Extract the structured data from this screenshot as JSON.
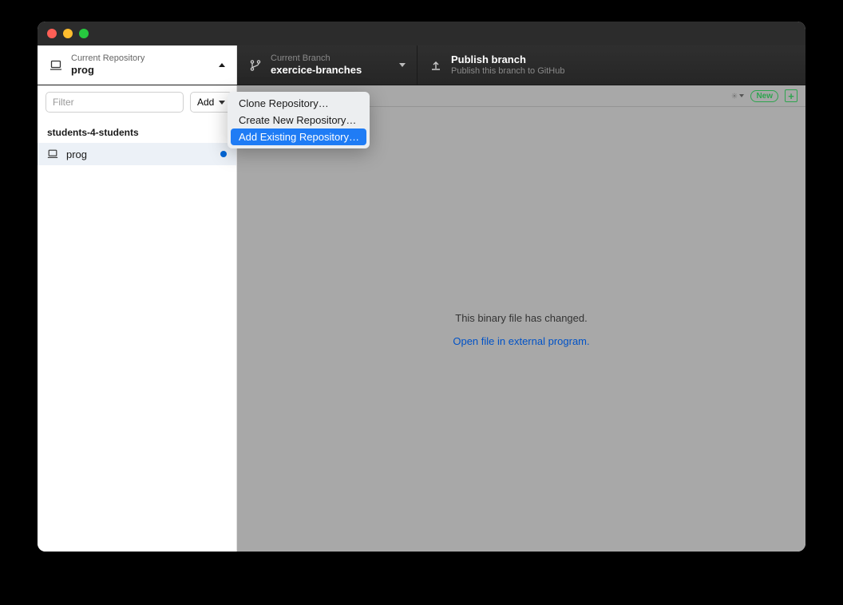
{
  "toolbar": {
    "repo": {
      "label": "Current Repository",
      "value": "prog"
    },
    "branch": {
      "label": "Current Branch",
      "value": "exercice-branches"
    },
    "publish": {
      "label": "Publish branch",
      "value": "Publish this branch to GitHub"
    }
  },
  "sidebar": {
    "filter_placeholder": "Filter",
    "add_button": "Add",
    "group_label": "students-4-students",
    "repo_items": [
      {
        "name": "prog",
        "current": true
      }
    ]
  },
  "add_menu": {
    "items": [
      {
        "label": "Clone Repository…",
        "highlighted": false
      },
      {
        "label": "Create New Repository…",
        "highlighted": false
      },
      {
        "label": "Add Existing Repository…",
        "highlighted": true
      }
    ]
  },
  "topbar": {
    "new_badge": "New"
  },
  "content": {
    "message": "This binary file has changed.",
    "link": "Open file in external program."
  }
}
